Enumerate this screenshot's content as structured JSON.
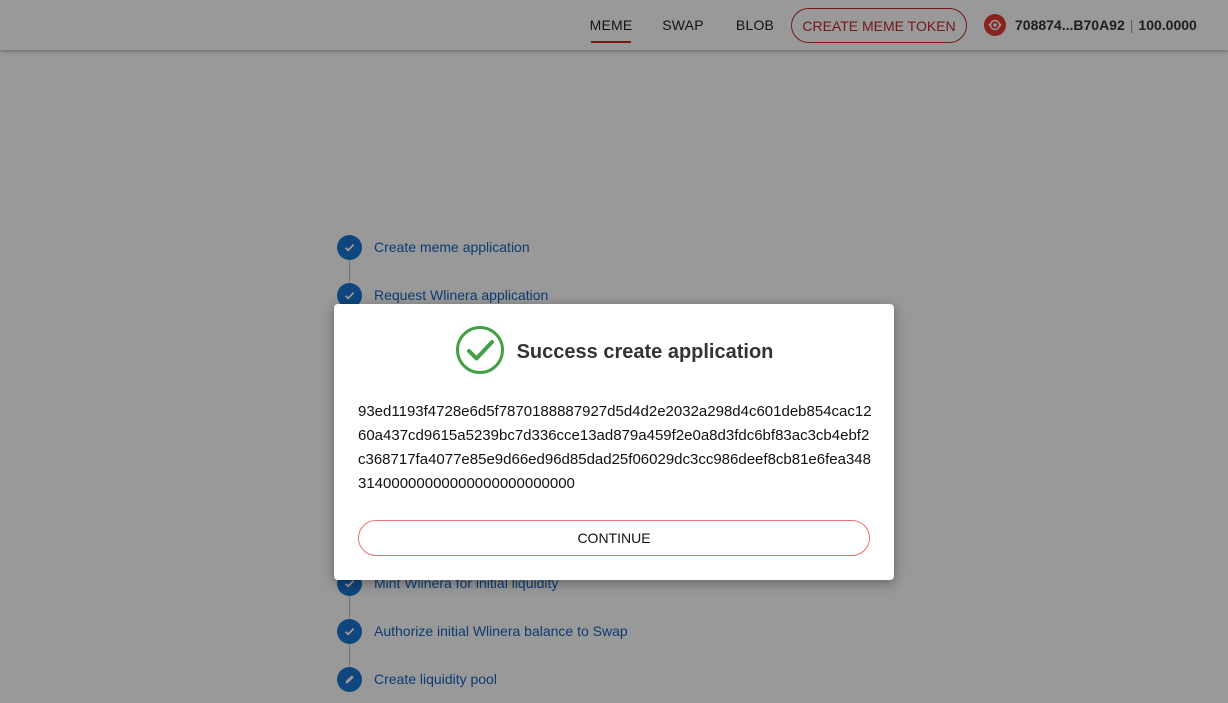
{
  "header": {
    "tabs": [
      {
        "label": "MEME",
        "active": true
      },
      {
        "label": "SWAP",
        "active": false
      },
      {
        "label": "BLOB",
        "active": false
      }
    ],
    "create_button": "CREATE MEME TOKEN",
    "account": {
      "logo_icon": "linera-logo-icon",
      "address": "708874...B70A92",
      "separator": "|",
      "balance": "100.0000"
    }
  },
  "steps": [
    {
      "label": "Create meme application",
      "icon": "check-icon"
    },
    {
      "label": "Request Wlinera application",
      "icon": "check-icon"
    },
    {
      "label": "Mint Wlinera for initial liquidity",
      "icon": "check-icon"
    },
    {
      "label": "Authorize initial Wlinera balance to Swap",
      "icon": "check-icon"
    },
    {
      "label": "Create liquidity pool",
      "icon": "pencil-icon"
    }
  ],
  "dialog": {
    "status_icon": "success-check-circle-icon",
    "title": "Success create application",
    "application_id": "93ed1193f4728e6d5f7870188887927d5d4d2e2032a298d4c601deb854cac1260a437cd9615a5239bc7d336cce13ad879a459f2e0a8d3fdc6bf83ac3cb4ebf2c368717fa4077e85e9d66ed96d85dad25f06029dc3cc986deef8cb81e6fea34831400000000000000000000000",
    "continue_label": "CONTINUE"
  },
  "colors": {
    "accent": "#c62828",
    "step_blue": "#1976d2",
    "success_green": "#43a047"
  }
}
